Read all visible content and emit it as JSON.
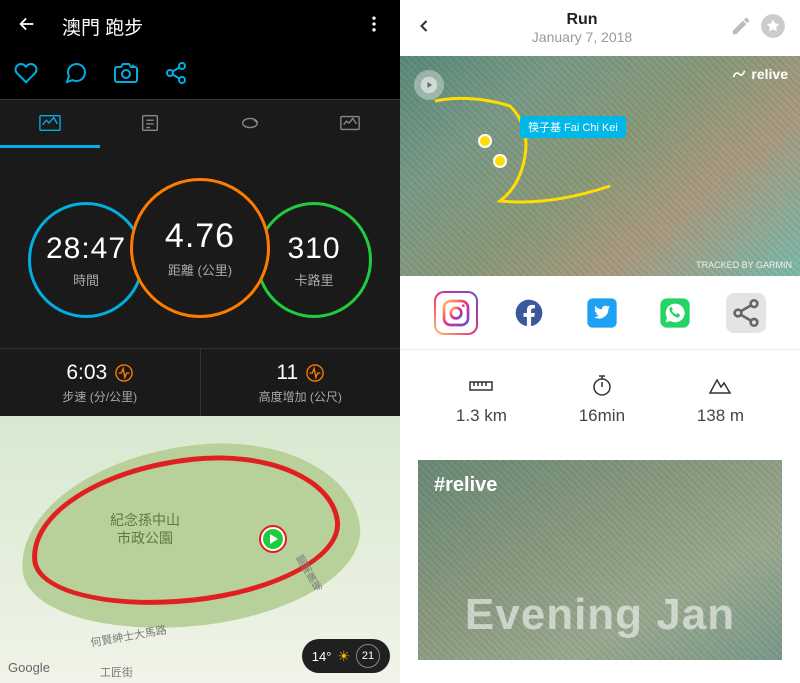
{
  "garmin": {
    "title": "澳門 跑步",
    "rings": {
      "center": {
        "value": "4.76",
        "label": "距離 (公里)"
      },
      "left": {
        "value": "28:47",
        "label": "時間"
      },
      "right": {
        "value": "310",
        "label": "卡路里"
      }
    },
    "stats": {
      "pace": {
        "value": "6:03",
        "label": "步速 (分/公里)"
      },
      "elev": {
        "value": "11",
        "label": "高度增加 (公尺)"
      }
    },
    "map": {
      "park_name": "紀念孫中山\n市政公園",
      "road1": "何賢紳士大馬路",
      "road2": "關閘廣場",
      "road3": "工匠街",
      "provider": "Google",
      "temp": "14°",
      "date": "21"
    }
  },
  "relive": {
    "title": "Run",
    "date": "January 7, 2018",
    "brand": "relive",
    "location_badge": "筷子基 Fai Chi Kei",
    "credit": "TRACKED BY GARMIN",
    "stats": {
      "distance": "1.3 km",
      "time": "16min",
      "elev": "138 m"
    },
    "hashtag": "#relive",
    "bigtext": "Evening Jan"
  }
}
